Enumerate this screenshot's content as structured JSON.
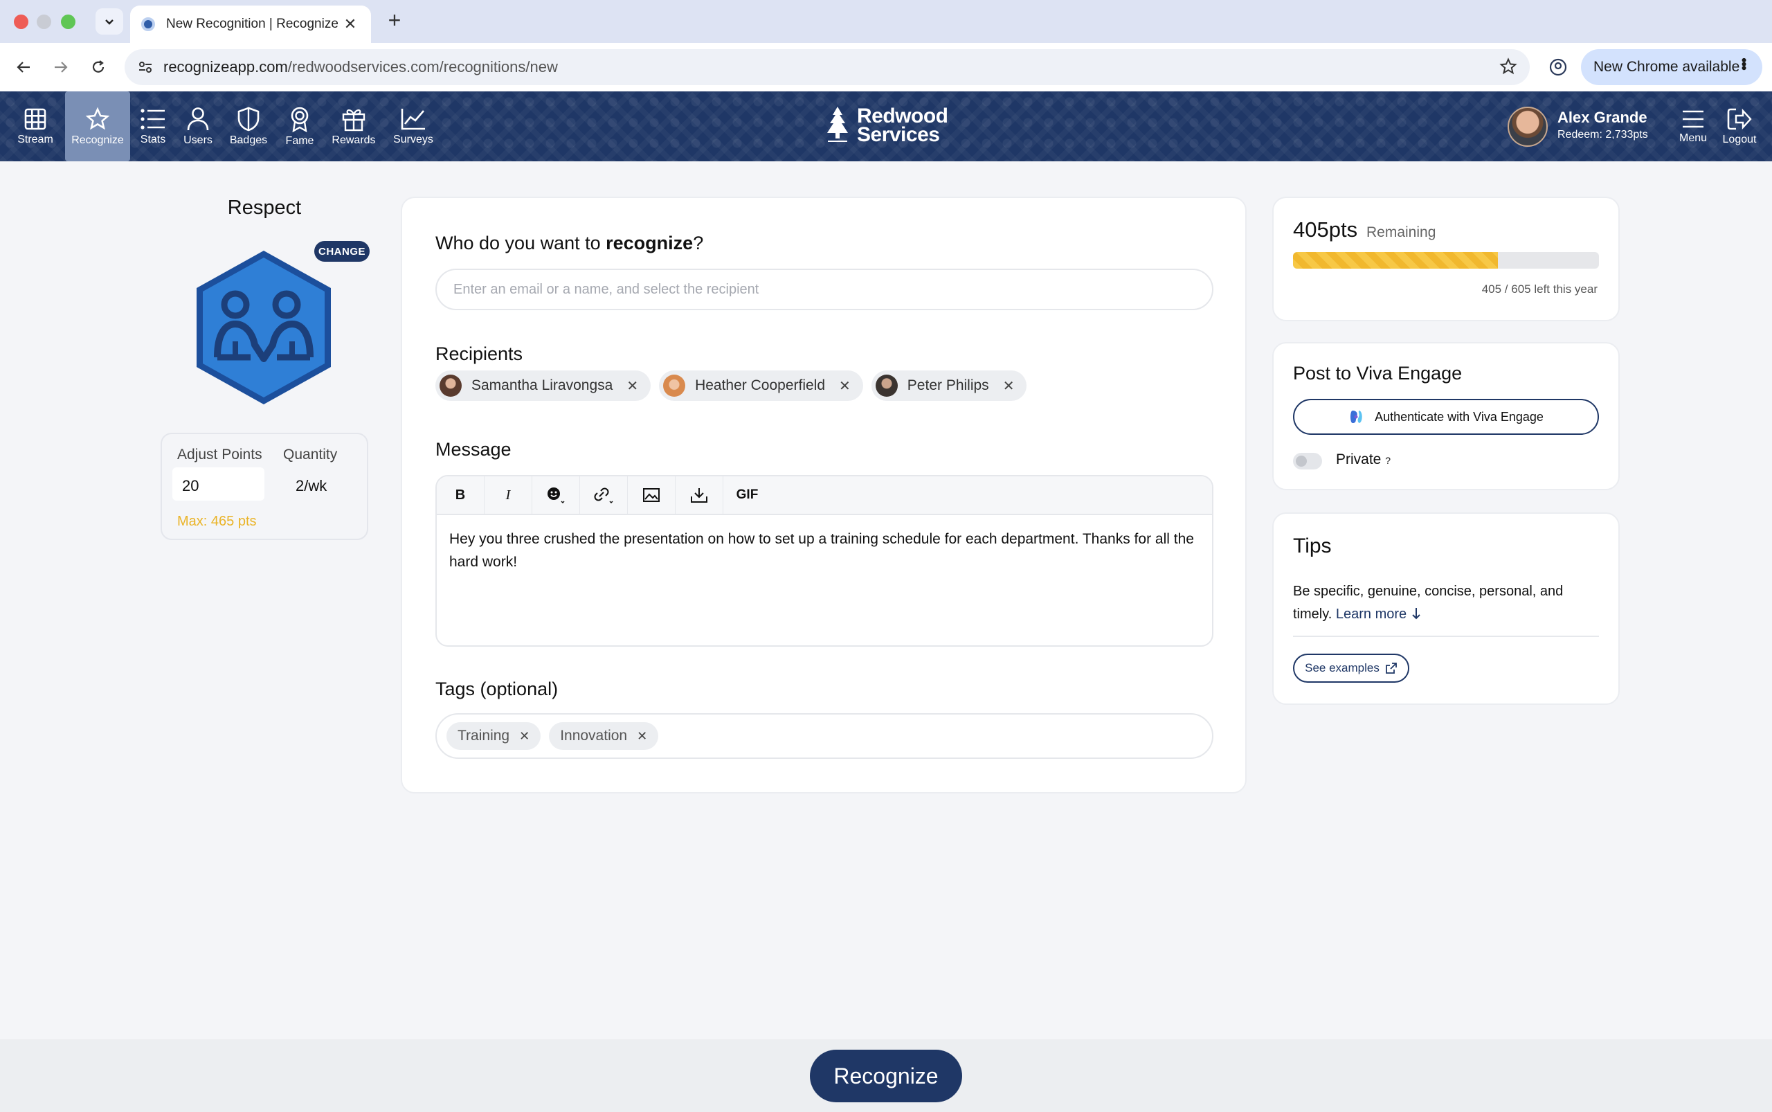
{
  "browser": {
    "tab_title": "New Recognition | Recognize",
    "url_host": "recognizeapp.com",
    "url_path": "/redwoodservices.com/recognitions/new",
    "update_label": "New Chrome available"
  },
  "nav": {
    "items": [
      {
        "label": "Stream",
        "icon": "grid-icon"
      },
      {
        "label": "Recognize",
        "icon": "star-icon"
      },
      {
        "label": "Stats",
        "icon": "list-icon"
      },
      {
        "label": "Users",
        "icon": "user-icon"
      },
      {
        "label": "Badges",
        "icon": "shield-icon"
      },
      {
        "label": "Fame",
        "icon": "award-icon"
      },
      {
        "label": "Rewards",
        "icon": "gift-icon"
      },
      {
        "label": "Surveys",
        "icon": "chart-line-icon"
      }
    ],
    "active": "Recognize",
    "brand_line1": "Redwood",
    "brand_line2": "Services",
    "user_name": "Alex Grande",
    "user_redeem": "Redeem: 2,733pts",
    "menu_label": "Menu",
    "logout_label": "Logout"
  },
  "badge": {
    "title": "Respect",
    "change_label": "CHANGE",
    "adjust_points_label": "Adjust Points",
    "adjust_points_value": "20",
    "quantity_label": "Quantity",
    "quantity_value": "2/wk",
    "max_label": "Max: 465 pts",
    "color": "#2f7fd6"
  },
  "form": {
    "question_prefix": "Who do you want to ",
    "question_bold": "recognize",
    "question_suffix": "?",
    "search_placeholder": "Enter an email or a name, and select the recipient",
    "recipients_label": "Recipients",
    "recipients": [
      {
        "name": "Samantha Liravongsa",
        "avatar_color": "#5a3b2e"
      },
      {
        "name": "Heather Cooperfield",
        "avatar_color": "#d98a4e"
      },
      {
        "name": "Peter Philips",
        "avatar_color": "#3b3430"
      }
    ],
    "message_label": "Message",
    "toolbar": {
      "bold": "B",
      "italic": "I",
      "gif": "GIF"
    },
    "message_text": "Hey you three crushed the presentation on how to set up a training schedule for each department. Thanks for all the hard work!",
    "tags_label": "Tags (optional)",
    "tags": [
      "Training",
      "Innovation"
    ]
  },
  "points": {
    "remaining_value": "405pts",
    "remaining_label": "Remaining",
    "progress_fraction": 0.669,
    "note": "405 / 605 left this year"
  },
  "viva": {
    "title": "Post to Viva Engage",
    "auth_label": "Authenticate with Viva Engage",
    "private_label": "Private",
    "private_help": "?"
  },
  "tips": {
    "title": "Tips",
    "body": "Be specific, genuine, concise, personal, and timely.",
    "learn_more": "Learn more",
    "see_examples": "See examples"
  },
  "footer": {
    "recognize_label": "Recognize"
  },
  "colors": {
    "brand_navy": "#1f3766",
    "accent_yellow": "#f7c846",
    "max_text": "#eab428"
  }
}
